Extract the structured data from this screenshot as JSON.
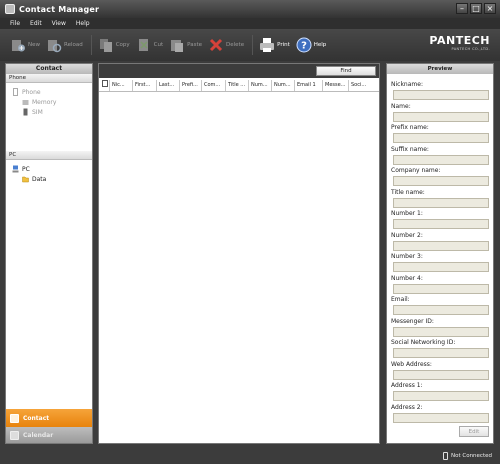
{
  "window": {
    "title": "Contact Manager"
  },
  "menu": [
    "File",
    "Edit",
    "View",
    "Help"
  ],
  "toolbar": {
    "buttons": [
      {
        "label": "New",
        "icon": "new-contact-icon",
        "enabled": false
      },
      {
        "label": "Reload",
        "icon": "reload-icon",
        "enabled": false
      },
      {
        "label": "Copy",
        "icon": "copy-icon",
        "enabled": false
      },
      {
        "label": "Cut",
        "icon": "cut-icon",
        "enabled": false
      },
      {
        "label": "Paste",
        "icon": "paste-icon",
        "enabled": false
      },
      {
        "label": "Delete",
        "icon": "delete-icon",
        "enabled": false
      },
      {
        "label": "Print",
        "icon": "printer-icon",
        "enabled": true
      },
      {
        "label": "Help",
        "icon": "help-icon",
        "enabled": true
      }
    ],
    "brand": "PANTECH",
    "brand_sub": "PANTECH CO.,LTD."
  },
  "left_panel": {
    "header": "Contact",
    "phone_section": "Phone",
    "phone_tree": [
      "Phone",
      "Memory",
      "SIM"
    ],
    "pc_section": "PC",
    "pc_tree": [
      "PC",
      "Data"
    ],
    "nav": {
      "contact": "Contact",
      "calendar": "Calendar"
    }
  },
  "middle_panel": {
    "find_label": "Find",
    "columns": [
      "Nic...",
      "First...",
      "Last...",
      "Prefi...",
      "Com...",
      "Title ...",
      "Num...",
      "Num...",
      "Email 1",
      "Messe...",
      "Soci..."
    ]
  },
  "right_panel": {
    "header": "Preview",
    "fields": [
      "Nickname:",
      "Name:",
      "Prefix name:",
      "Suffix name:",
      "Company name:",
      "Title name:",
      "Number 1:",
      "Number 2:",
      "Number 3:",
      "Number 4:",
      "Email:",
      "Messenger ID:",
      "Social Networking ID:",
      "Web Address:",
      "Address 1:",
      "Address 2:"
    ],
    "edit_label": "Edit"
  },
  "status": {
    "connection": "Not Connected"
  },
  "colors": {
    "accent": "#e8830c",
    "chrome": "#3c3c3c",
    "field_bg": "#eceadf"
  }
}
